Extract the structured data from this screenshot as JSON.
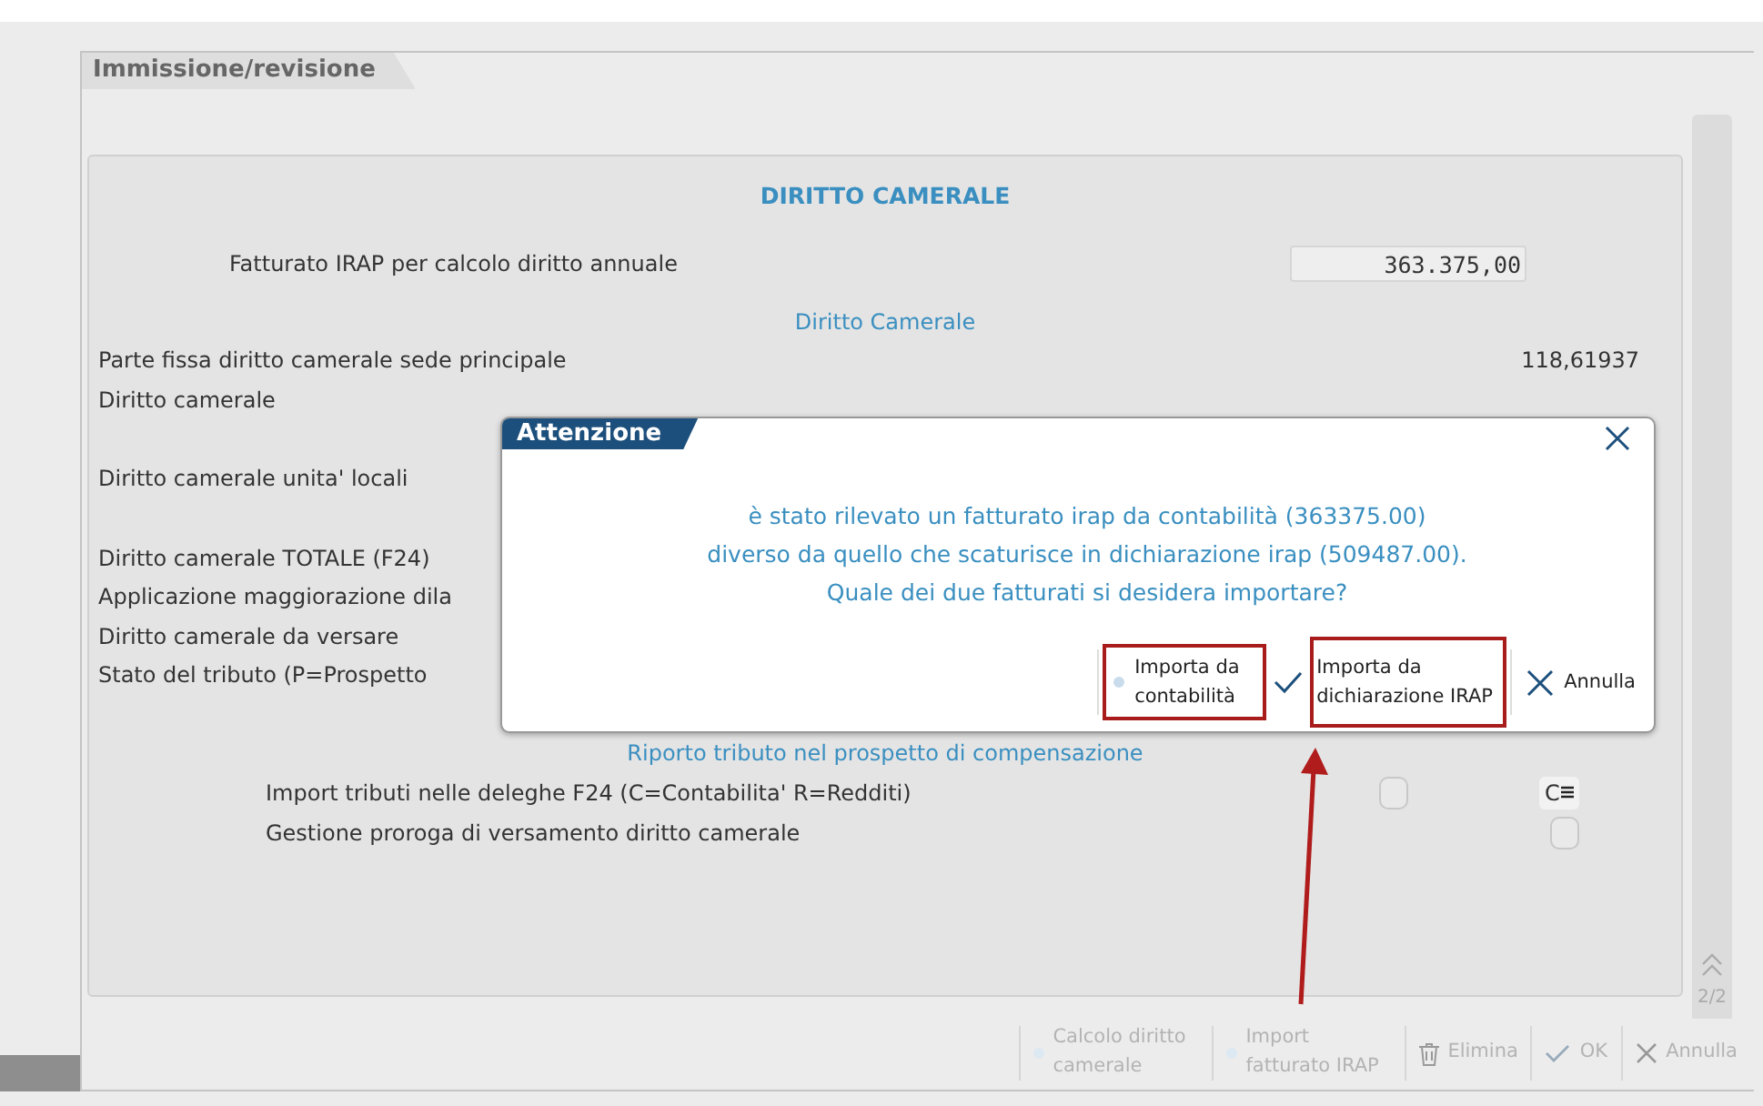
{
  "window": {
    "tab": "Immissione/revisione"
  },
  "section": {
    "title": "DIRITTO CAMERALE",
    "revenue_field": {
      "label": "Fatturato IRAP per calcolo diritto annuale",
      "value": "363.375,00"
    },
    "subtitle": "Diritto Camerale",
    "groups": [
      [
        {
          "label": "Parte fissa diritto camerale sede principale",
          "value": "118,61937"
        },
        {
          "label": "Diritto camerale"
        }
      ],
      [
        {
          "label": "Diritto camerale unita' locali"
        }
      ],
      [
        {
          "label": "Diritto camerale TOTALE (F24)"
        },
        {
          "label": "Applicazione maggiorazione dila"
        },
        {
          "label": "Diritto camerale da versare"
        },
        {
          "label": "Stato del tributo (P=Prospetto"
        }
      ]
    ],
    "subtitle_2": "Riporto tributo nel prospetto di compensazione",
    "options": [
      {
        "label": "Import tributi nelle deleghe F24 (C=Contabilita' R=Redditi)",
        "checked": false,
        "select_value": "C"
      },
      {
        "label": "Gestione proroga di versamento diritto camerale",
        "checked": false
      }
    ]
  },
  "pager": "2/2",
  "toolbar": [
    {
      "label": "Calcolo diritto camerale",
      "kind": "dot",
      "disabled": true
    },
    {
      "label": "Import fatturato IRAP",
      "kind": "dot",
      "disabled": true
    },
    {
      "label": "Elimina",
      "kind": "trash",
      "disabled": true
    },
    {
      "label": "OK",
      "kind": "check",
      "disabled": true
    },
    {
      "label": "Annulla",
      "kind": "close",
      "disabled": true
    }
  ],
  "dialog": {
    "title": "Attenzione",
    "message": [
      "è stato rilevato un fatturato irap da contabilità (363375.00)",
      "diverso da quello che scaturisce in dichiarazione irap (509487.00).",
      "Quale dei due fatturati si desidera importare?"
    ],
    "buttons": [
      {
        "label": "Importa da contabilità",
        "kind": "dot",
        "highlighted": true
      },
      {
        "label": "Importa da dichiarazione IRAP",
        "kind": "check",
        "highlighted": true
      },
      {
        "label": "Annulla",
        "kind": "close",
        "highlighted": false
      }
    ]
  }
}
